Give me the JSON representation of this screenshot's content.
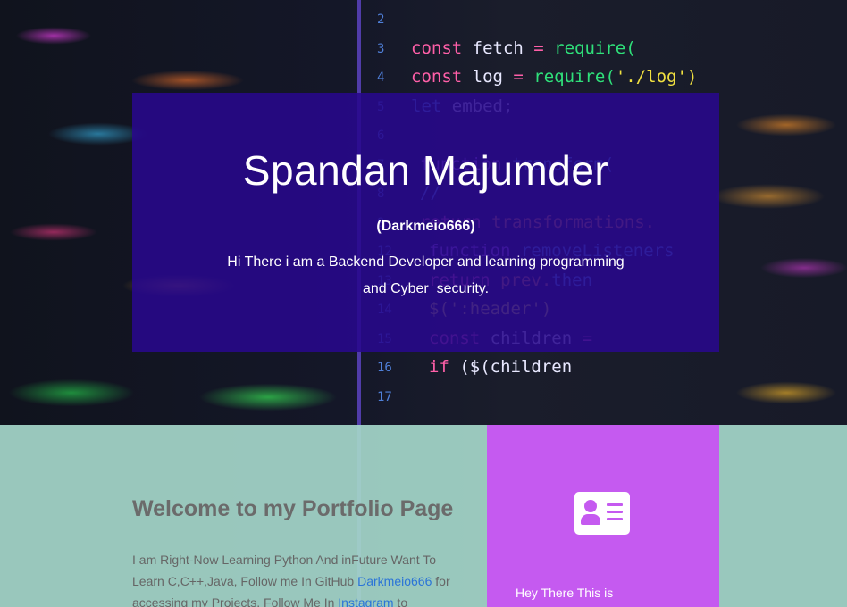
{
  "background_code": {
    "lines": [
      {
        "num": "2",
        "parts": []
      },
      {
        "num": "3",
        "parts": [
          {
            "t": "const ",
            "c": "c-pink"
          },
          {
            "t": "fetch ",
            "c": "c-white"
          },
          {
            "t": "= ",
            "c": "c-pink"
          },
          {
            "t": "require(",
            "c": "c-green"
          }
        ]
      },
      {
        "num": "4",
        "parts": [
          {
            "t": "const ",
            "c": "c-pink"
          },
          {
            "t": "log ",
            "c": "c-white"
          },
          {
            "t": "= ",
            "c": "c-pink"
          },
          {
            "t": "require(",
            "c": "c-green"
          },
          {
            "t": "'./log')",
            "c": "c-yellow"
          }
        ]
      },
      {
        "num": "5",
        "parts": [
          {
            "t": "let ",
            "c": "c-blue"
          },
          {
            "t": "embed;",
            "c": "c-white"
          }
        ]
      },
      {
        "num": "6",
        "parts": []
      },
      {
        "num": "7",
        "parts": [
          {
            "t": "function ",
            "c": "c-purple"
          },
          {
            "t": "transform(",
            "c": "c-blue"
          }
        ]
      },
      {
        "num": "8",
        "parts": [
          {
            "t": "// ",
            "c": "c-blue"
          }
        ]
      },
      {
        "num": "9",
        "parts": [
          {
            "t": "return ",
            "c": "c-pink"
          },
          {
            "t": "transformations.",
            "c": "c-orange"
          }
        ]
      },
      {
        "num": "12",
        "parts": [
          {
            "t": "function ",
            "c": "c-purple"
          },
          {
            "t": "removeListeners",
            "c": "c-blue"
          }
        ]
      },
      {
        "num": "13",
        "parts": [
          {
            "t": "return ",
            "c": "c-pink"
          },
          {
            "t": "prev.",
            "c": "c-orange"
          },
          {
            "t": "then",
            "c": "c-blue"
          }
        ]
      },
      {
        "num": "14",
        "parts": [
          {
            "t": "$(':header')",
            "c": "c-yellow"
          }
        ]
      },
      {
        "num": "15",
        "parts": [
          {
            "t": "const ",
            "c": "c-pink"
          },
          {
            "t": "children ",
            "c": "c-white"
          },
          {
            "t": "= ",
            "c": "c-pink"
          }
        ]
      },
      {
        "num": "16",
        "parts": [
          {
            "t": "if ",
            "c": "c-pink"
          },
          {
            "t": "($(children",
            "c": "c-white"
          }
        ]
      },
      {
        "num": "17",
        "parts": []
      }
    ]
  },
  "hero": {
    "title": "Spandan Majumder",
    "handle": "(Darkmeio666)",
    "description": "Hi There i am a Backend Developer and learning programming and Cyber_security."
  },
  "welcome": {
    "title": "Welcome to my Portfolio Page",
    "text_1": "I am Right-Now Learning Python And inFuture Want To Learn C,C++,Java, Follow me In GitHub ",
    "github_link": "Darkmeio666",
    "text_2": " for accessing my Projects, Follow Me In ",
    "instagram_link": "Instagram",
    "text_3": " to"
  },
  "card": {
    "icon": "id-card-icon",
    "text": "Hey There This is"
  },
  "colors": {
    "hero_bg": "#28088c",
    "lower_bg": "#a5d7ca",
    "card_bg": "#c55af0",
    "link": "#2a74d8"
  }
}
